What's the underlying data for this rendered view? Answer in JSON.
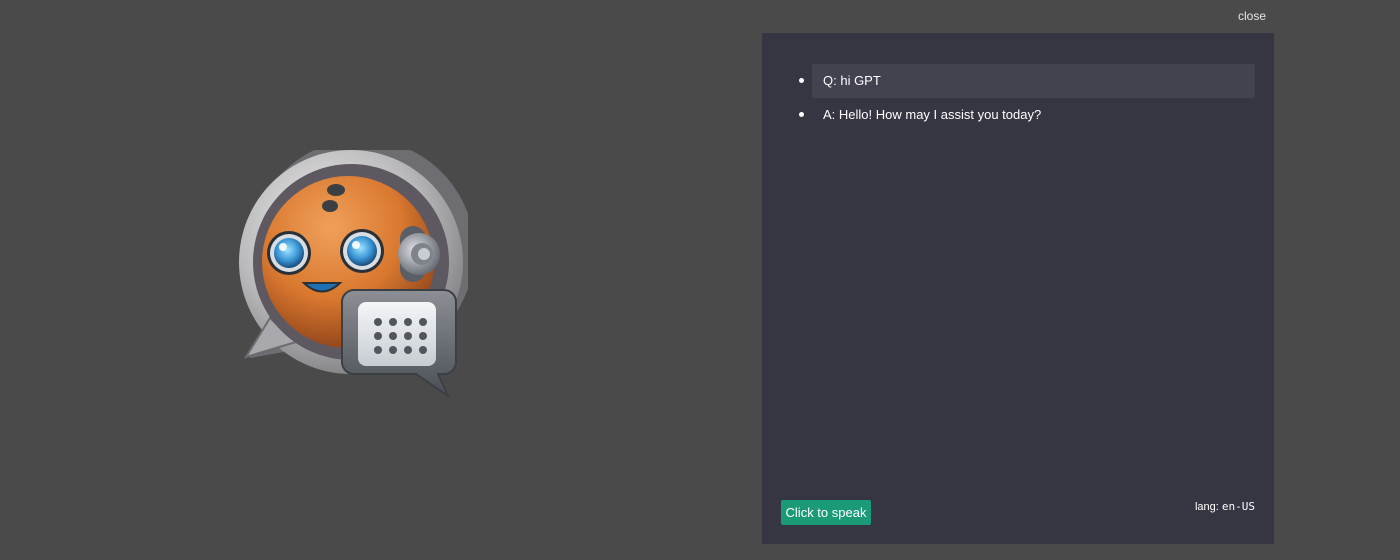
{
  "header": {
    "close_label": "close"
  },
  "logo": {
    "icon": "robot-chat-logo"
  },
  "chat": {
    "messages": [
      {
        "text": "Q: hi GPT",
        "highlighted": true
      },
      {
        "text": "A: Hello! How may I assist you today?",
        "highlighted": false
      }
    ]
  },
  "controls": {
    "speak_label": "Click to speak",
    "lang_label": "lang:",
    "lang_value": "en-US"
  },
  "colors": {
    "page_background": "#4a4a4a",
    "panel_background": "#363542",
    "message_highlight": "#43424f",
    "speak_button": "#1a9a77"
  }
}
